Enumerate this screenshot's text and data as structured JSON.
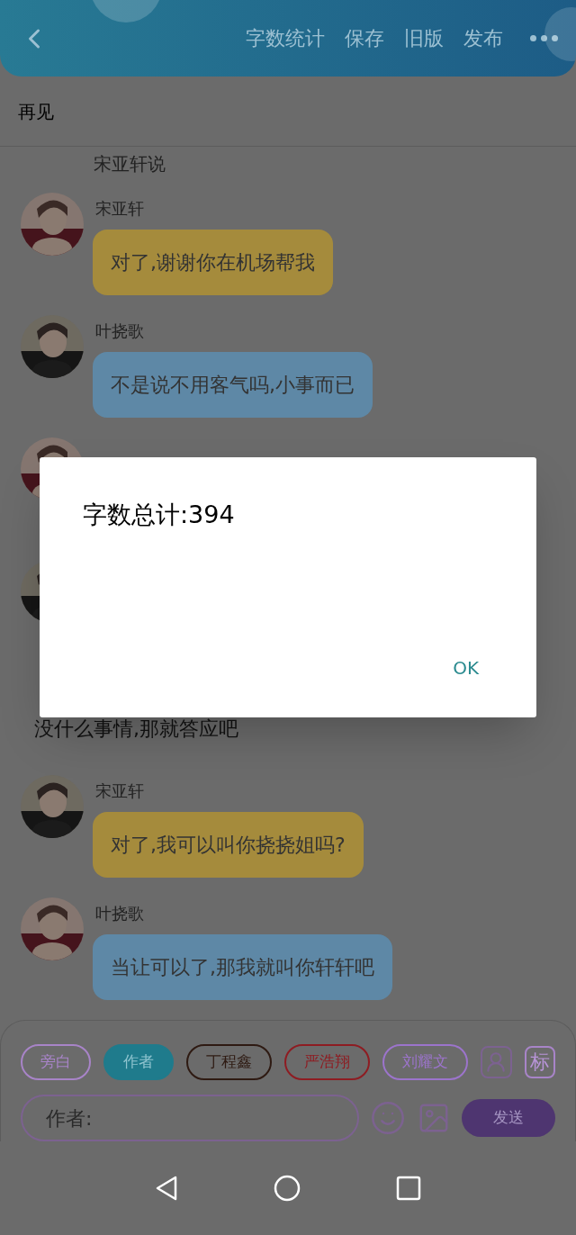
{
  "header": {
    "actions": [
      "字数统计",
      "保存",
      "旧版",
      "发布"
    ]
  },
  "title": "再见",
  "chat": [
    {
      "kind": "fragment",
      "text": "宋亚轩说"
    },
    {
      "kind": "message",
      "name": "宋亚轩",
      "text": "对了,谢谢你在机场帮我",
      "color": "#a58b3c"
    },
    {
      "kind": "message",
      "name": "叶挠歌",
      "text": "不是说不用客气吗,小事而已",
      "color": "#5e88a6"
    },
    {
      "kind": "message"
    },
    {
      "kind": "message"
    },
    {
      "kind": "narration",
      "text": "没什么事情,那就答应吧"
    },
    {
      "kind": "message",
      "name": "宋亚轩",
      "text": "对了,我可以叫你挠挠姐吗?",
      "color": "#a58b3c"
    },
    {
      "kind": "message",
      "name": "叶挠歌",
      "text": "当让可以了,那我就叫你轩轩吧",
      "color": "#5e88a6"
    }
  ],
  "roles": [
    {
      "label": "旁白",
      "selected": false,
      "color": "#a884c8"
    },
    {
      "label": "作者",
      "selected": true,
      "color": "#1f7b8c"
    },
    {
      "label": "丁程鑫",
      "selected": false,
      "color": "#2e1a12"
    },
    {
      "label": "严浩翔",
      "selected": false,
      "color": "#8e1c22"
    },
    {
      "label": "刘耀文",
      "selected": false,
      "color": "#9c74cc"
    }
  ],
  "tag_button": "标",
  "input": {
    "placeholder": "作者:"
  },
  "send": "发送",
  "dialog": {
    "message": "字数总计:394",
    "button": "OK"
  }
}
